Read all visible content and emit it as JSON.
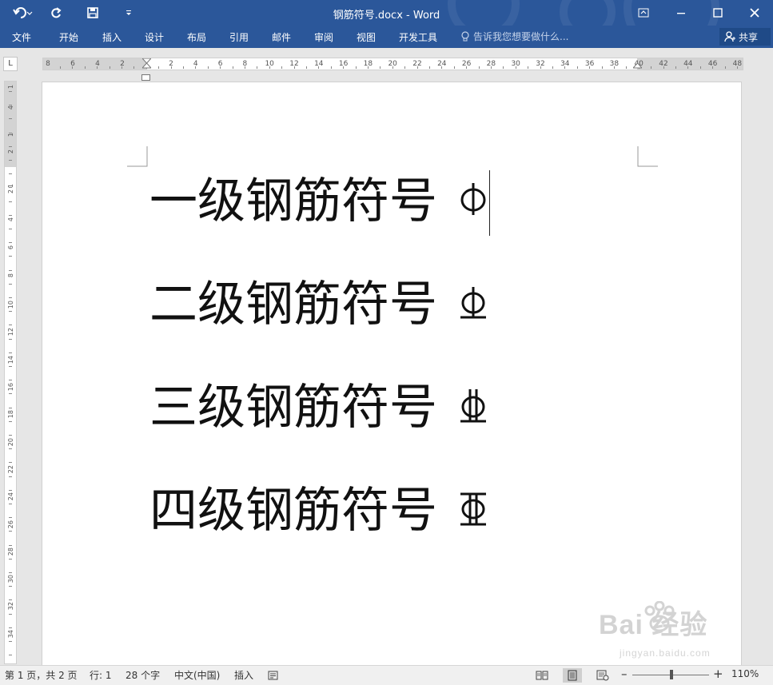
{
  "window": {
    "title": "钢筋符号.docx - Word",
    "accent_color": "#2b579a"
  },
  "qat": {
    "undo_icon": "undo-icon",
    "redo_icon": "redo-icon",
    "save_icon": "save-icon",
    "customize_icon": "customize-icon"
  },
  "tabs": [
    "文件",
    "开始",
    "插入",
    "设计",
    "布局",
    "引用",
    "邮件",
    "审阅",
    "视图",
    "开发工具"
  ],
  "tell_me": {
    "placeholder": "告诉我您想要做什么..."
  },
  "share": {
    "label": "共享"
  },
  "ruler": {
    "tab_selector": "L",
    "h_ticks": [
      "8",
      "6",
      "4",
      "2",
      "2",
      "4",
      "6",
      "8",
      "10",
      "12",
      "14",
      "16",
      "18",
      "20",
      "22",
      "24",
      "26",
      "28",
      "30",
      "32",
      "34",
      "36",
      "38",
      "40",
      "42",
      "44",
      "46",
      "48"
    ],
    "v_ticks": [
      "1",
      "4",
      "1",
      "2",
      "1",
      "2",
      "4",
      "6",
      "8",
      "10",
      "12",
      "14",
      "16",
      "18",
      "20",
      "22",
      "24",
      "26",
      "28",
      "30",
      "32",
      "34"
    ]
  },
  "document": {
    "lines": [
      {
        "text": "一级钢筋符号",
        "symbol": "grade-1-rebar-symbol"
      },
      {
        "text": "二级钢筋符号",
        "symbol": "grade-2-rebar-symbol"
      },
      {
        "text": "三级钢筋符号",
        "symbol": "grade-3-rebar-symbol"
      },
      {
        "text": "四级钢筋符号",
        "symbol": "grade-4-rebar-symbol"
      }
    ]
  },
  "watermark": {
    "text": "Bai 经验",
    "sub": "jingyan.baidu.com"
  },
  "status": {
    "page": "第 1 页，共 2 页",
    "line": "行: 1",
    "words": "28 个字",
    "language": "中文(中国)",
    "mode": "插入",
    "zoom": "110%",
    "zoom_value": 110
  }
}
